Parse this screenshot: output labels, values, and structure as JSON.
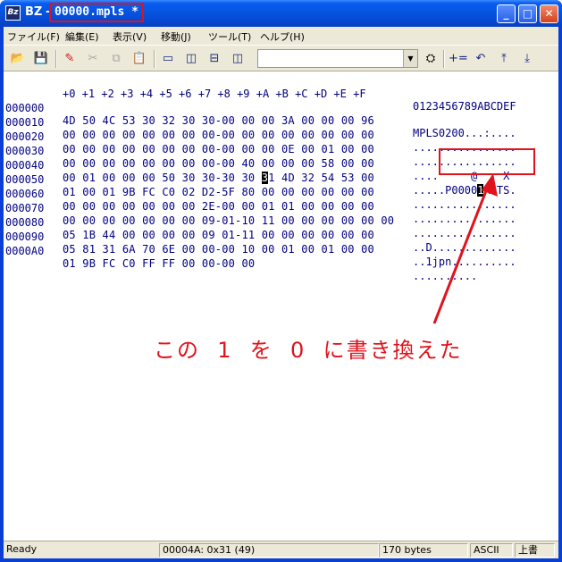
{
  "window": {
    "app_icon": "Bz",
    "app_name": "BZ",
    "dash": "-",
    "filename": "00000.mpls *",
    "buttons": {
      "minimize": "_",
      "maximize": "□",
      "close": "✕"
    }
  },
  "menu": [
    "ファイル(F)",
    "編集(E)",
    "表示(V)",
    "移動(J)",
    "ツール(T)",
    "ヘルプ(H)"
  ],
  "toolbar": {
    "icons": [
      "open-folder-icon",
      "save-icon",
      "edit-icon",
      "cut-icon",
      "copy-icon",
      "paste-icon",
      "view-single-icon",
      "view-split-vertical-icon",
      "view-split-horizontal-icon",
      "view-columns-icon",
      "binoculars-icon",
      "add-icon",
      "undo-icon",
      "jump-top-icon",
      "jump-bottom-icon"
    ],
    "search_value": ""
  },
  "editor": {
    "header_hex": "+0 +1 +2 +3 +4 +5 +6 +7 +8 +9 +A +B +C +D +E +F",
    "header_ascii": "0123456789ABCDEF",
    "rows": [
      {
        "addr": "000000",
        "hex": "4D 50 4C 53 30 32 30 30-00 00 00 3A 00 00 00 96",
        "ascii": "MPLS0200...:...."
      },
      {
        "addr": "000010",
        "hex": "00 00 00 00 00 00 00 00-00 00 00 00 00 00 00 00",
        "ascii": "................"
      },
      {
        "addr": "000020",
        "hex": "00 00 00 00 00 00 00 00-00 00 00 0E 00 01 00 00",
        "ascii": "................"
      },
      {
        "addr": "000030",
        "hex": "00 00 00 00 00 00 00 00-00 40 00 00 00 58 00 00",
        "ascii": "....     @    X  "
      },
      {
        "addr": "000040",
        "hex_pre": "00 01 00 00 00 50 30 30-30 30 ",
        "hex_hl": "3",
        "hex_post": "1 4D 32 54 53 00",
        "ascii_pre": ".....P0000",
        "ascii_hl": "1",
        "ascii_post": "M2TS."
      },
      {
        "addr": "000050",
        "hex": "01 00 01 9B FC C0 02 D2-5F 80 00 00 00 00 00 00",
        "ascii": "................"
      },
      {
        "addr": "000060",
        "hex": "00 00 00 00 00 00 00 2E-00 00 01 01 00 00 00 00",
        "ascii": "................"
      },
      {
        "addr": "000070",
        "hex": "00 00 00 00 00 00 00 09-01-10 11 00 00 00 00 00 00",
        "ascii": "................"
      },
      {
        "addr": "000080",
        "hex": "05 1B 44 00 00 00 00 09 01-11 00 00 00 00 00 00",
        "ascii": "..D............."
      },
      {
        "addr": "000090",
        "hex": "05 81 31 6A 70 6E 00 00-00 10 00 01 00 01 00 00",
        "ascii": "..1jpn.........."
      },
      {
        "addr": "0000A0",
        "hex": "01 9B FC C0 FF FF 00 00-00 00",
        "ascii": ".........."
      }
    ]
  },
  "annotation": {
    "text": "この  1  を  0  に書き換えた",
    "color": "#e0121c"
  },
  "status": {
    "ready": "Ready",
    "position": "00004A: 0x31 (49)",
    "size": "170 bytes",
    "encoding": "ASCII",
    "mode": "上書"
  },
  "colors": {
    "titlebar": "#0653e0",
    "face": "#ece9d8",
    "highlight_red": "#e0121c"
  }
}
